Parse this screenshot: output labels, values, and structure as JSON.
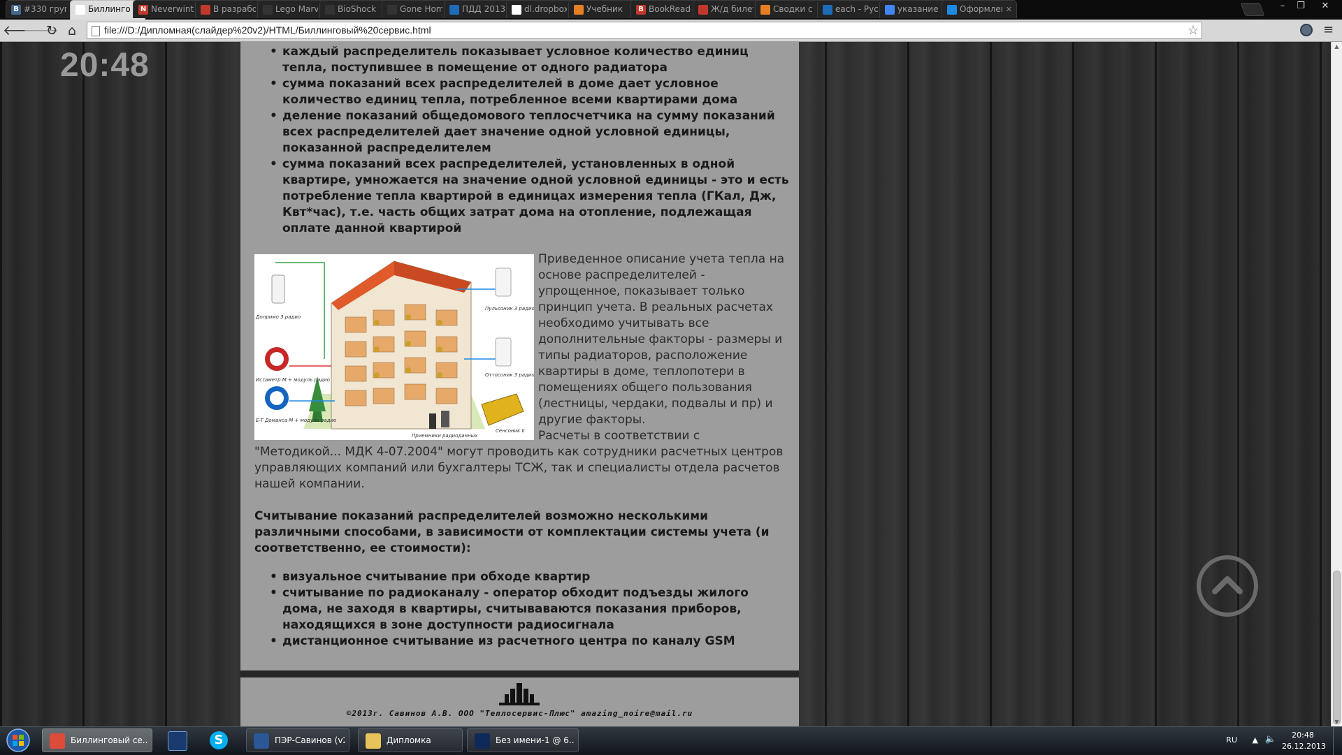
{
  "browser": {
    "tabs": [
      {
        "label": "#330 групп",
        "icon_color": "#45668e",
        "icon_char": "В"
      },
      {
        "label": "Биллинговый сервис",
        "icon_color": "#ffffff",
        "icon_char": ""
      },
      {
        "label": "Neverwinter",
        "icon_color": "#c0392b",
        "icon_char": "N"
      },
      {
        "label": "В разработке",
        "icon_color": "#c0392b",
        "icon_char": ""
      },
      {
        "label": "Lego Marvel",
        "icon_color": "#333333",
        "icon_char": ""
      },
      {
        "label": "BioShock",
        "icon_color": "#333333",
        "icon_char": ""
      },
      {
        "label": "Gone Home",
        "icon_color": "#333333",
        "icon_char": ""
      },
      {
        "label": "ПДД 2013",
        "icon_color": "#1e6bb8",
        "icon_char": ""
      },
      {
        "label": "dl.dropbox",
        "icon_color": "#ffffff",
        "icon_char": ""
      },
      {
        "label": "Учебник",
        "icon_color": "#e67e22",
        "icon_char": ""
      },
      {
        "label": "BookReader",
        "icon_color": "#c0392b",
        "icon_char": "B"
      },
      {
        "label": "Ж/д билеты",
        "icon_color": "#c0392b",
        "icon_char": ""
      },
      {
        "label": "Сводки с",
        "icon_color": "#e67e22",
        "icon_char": ""
      },
      {
        "label": "each - Русск",
        "icon_color": "#1e6bb8",
        "icon_char": ""
      },
      {
        "label": "указание",
        "icon_color": "#4285f4",
        "icon_char": ""
      },
      {
        "label": "Оформление",
        "icon_color": "#1e88e5",
        "icon_char": ""
      }
    ],
    "address": "file:///D:/Дипломная(слайдер%20v2)/HTML/Биллинговый%20сервис.html"
  },
  "page": {
    "clock": "20:48",
    "list1": [
      "каждый распределитель показывает условное количество единиц тепла, поступившее в помещение от одного радиатора",
      "сумма показаний всех распределителей в доме дает условное количество единиц тепла, потребленное всеми квартирами дома",
      "деление показаний общедомового теплосчетчика на сумму показаний всех распределителей дает значение одной условной единицы, показанной распределителем",
      "сумма показаний всех распределителей, установленных в одной квартире, умножается на значение одной условной единицы - это и есть потребление тепла квартирой в единицах измерения тепла (ГКал, Дж, Квт*час), т.е. часть общих затрат дома на отопление, подлежащая оплате данной квартирой"
    ],
    "description_1": "Приведенное описание учета тепла на основе распределителей - упрощенное, показывает только принцип учета. В реальных расчетах необходимо учитывать все дополнительные факторы - размеры и типы радиаторов, расположение квартиры в доме, теплопотери в помещениях общего пользования (лестницы, чердаки, подвалы и пр) и другие факторы.",
    "description_2": "Расчеты в соответствии с \"Методикой... МДК 4-07.2004\" могут проводить как сотрудники расчетных центров управляющих компаний или бухгалтеры ТСЖ, так и специалисты отдела расчетов нашей компании.",
    "diagram_labels": {
      "doprimo": "Допримо 3 радио",
      "istameter": "Истаметр М + модуль радио",
      "et": "E-T Доманса М + модуль радио",
      "pulsonic": "Пульсоник 3 радио",
      "ottosonic": "Оттосоник 3 радио",
      "sensonic": "Сенсоник II",
      "receivers": "Приемники радиоданных"
    },
    "reading_heading": "Считывание показаний распределителей возможно несколькими различными способами, в зависимости от комплектации системы учета (и соответственно, ее стоимости):",
    "list2": [
      "визуальное считывание при обходе квартир",
      "считывание по радиоканалу - оператор обходит подъезды жилого дома, не заходя в квартиры, считываваются показания приборов, находящихся в зоне доступности радиосигнала",
      "дистанционное считывание из расчетного центра по каналу GSM"
    ],
    "footer": "©2013г. Савинов А.В. ООО \"Теплосервис-Плюс\" amazing_noire@mail.ru"
  },
  "taskbar": {
    "items": [
      {
        "label": "Биллинговый се...",
        "icon_color": "#dd4b39"
      },
      {
        "label": "ПЭР-Савинов (v2...",
        "icon_color": "#2b5797"
      },
      {
        "label": "Дипломка",
        "icon_color": "#e8c35a"
      },
      {
        "label": "Без имени-1 @ 6...",
        "icon_color": "#0f2a5a"
      }
    ],
    "lang": "RU",
    "time": "20:48",
    "date": "26.12.2013"
  }
}
